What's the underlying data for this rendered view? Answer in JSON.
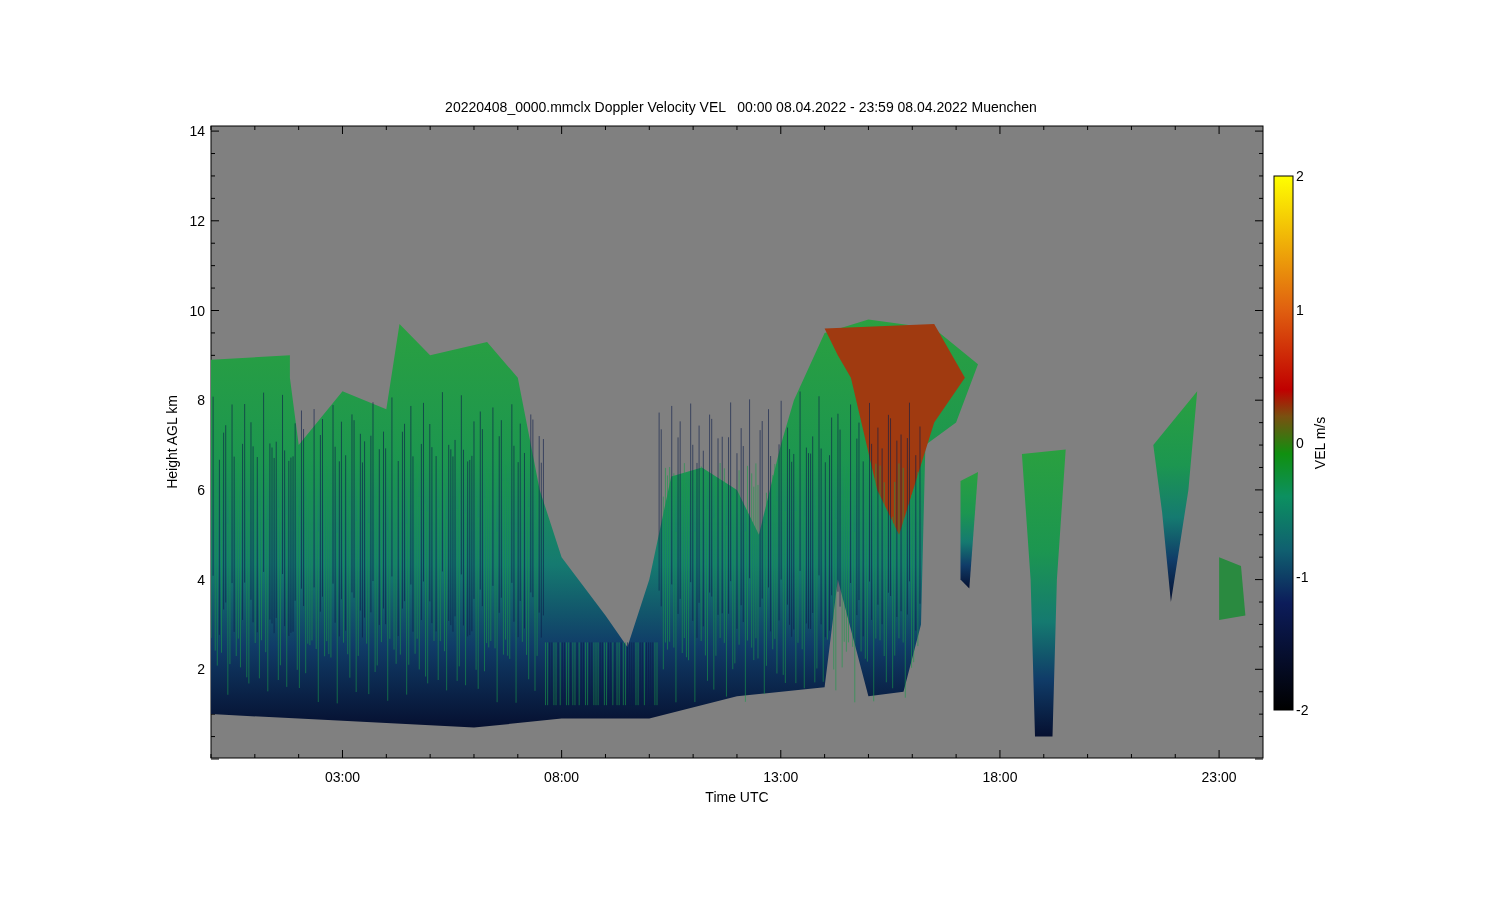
{
  "title": "20220408_0000.mmclx Doppler Velocity VEL   00:00 08.04.2022 - 23:59 08.04.2022 Muenchen",
  "x_axis": {
    "label": "Time UTC",
    "ticks": [
      "03:00",
      "08:00",
      "13:00",
      "18:00",
      "23:00"
    ]
  },
  "y_axis": {
    "label": "Height AGL km",
    "ticks": [
      "14",
      "12",
      "10",
      "8",
      "6",
      "4",
      "2"
    ]
  },
  "colorbar": {
    "label": "VEL m/s",
    "ticks": [
      "2",
      "1",
      "0",
      "-1",
      "-2"
    ]
  }
}
